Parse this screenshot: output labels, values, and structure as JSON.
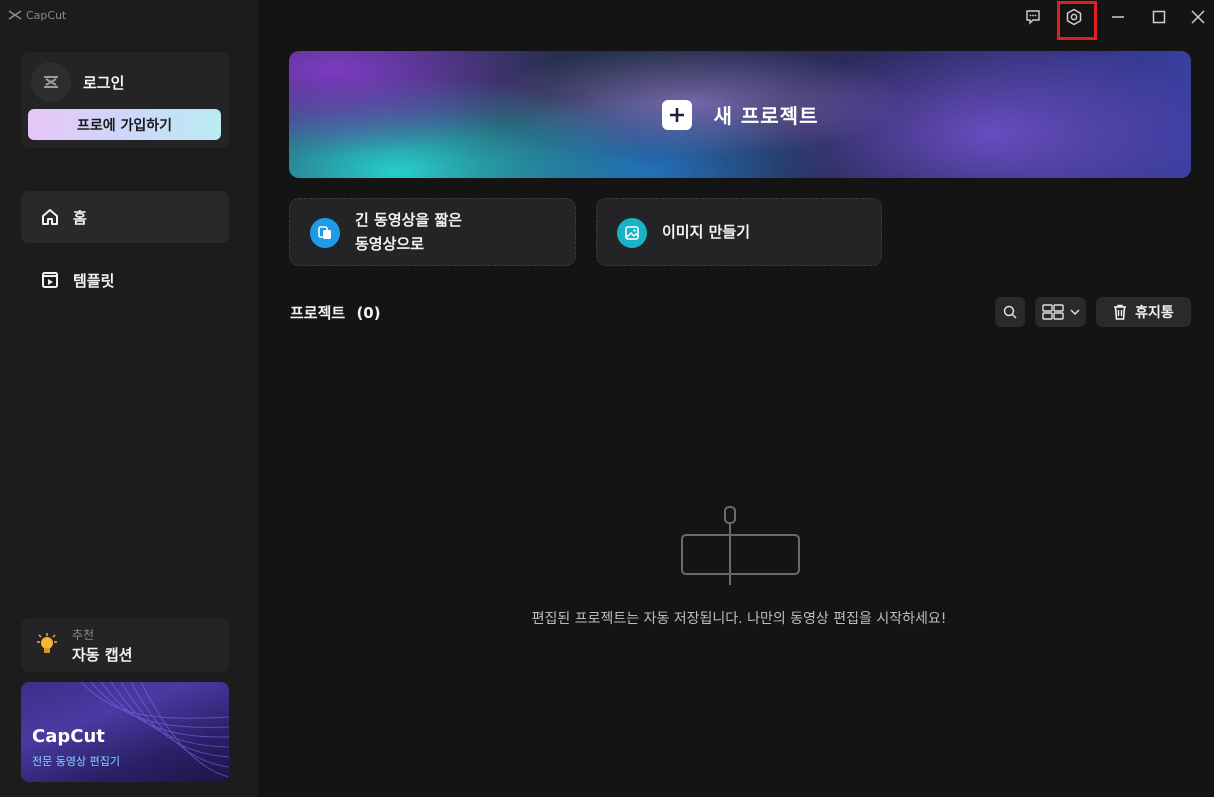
{
  "app": {
    "title": "CapCut"
  },
  "sidebar": {
    "login_label": "로그인",
    "pro_button": "프로에 가입하기",
    "nav": [
      {
        "label": "홈",
        "icon": "home-icon",
        "active": true
      },
      {
        "label": "템플릿",
        "icon": "template-icon",
        "active": false
      }
    ],
    "recommend": {
      "small": "추천",
      "title": "자동 캡션",
      "icon": "lightbulb-icon"
    },
    "promo": {
      "title": "CapCut",
      "subtitle": "전문 동영상 편집기"
    }
  },
  "window_controls": [
    "feedback-icon",
    "settings-icon",
    "minimize-icon",
    "maximize-icon",
    "close-icon"
  ],
  "main": {
    "new_project": "새 프로젝트",
    "features": [
      {
        "line1": "긴 동영상을 짧은",
        "line2": "동영상으로",
        "icon": "long-to-short-icon"
      },
      {
        "line1": "이미지 만들기",
        "icon": "image-create-icon"
      }
    ],
    "projects": {
      "label": "프로젝트",
      "count": "(0)"
    },
    "trash_label": "휴지통",
    "empty_message": "편집된 프로젝트는 자동 저장됩니다. 나만의 동영상 편집을 시작하세요!"
  },
  "colors": {
    "accent_highlight": "#e02020",
    "background": "#141414",
    "sidebar": "#1c1c1d"
  }
}
